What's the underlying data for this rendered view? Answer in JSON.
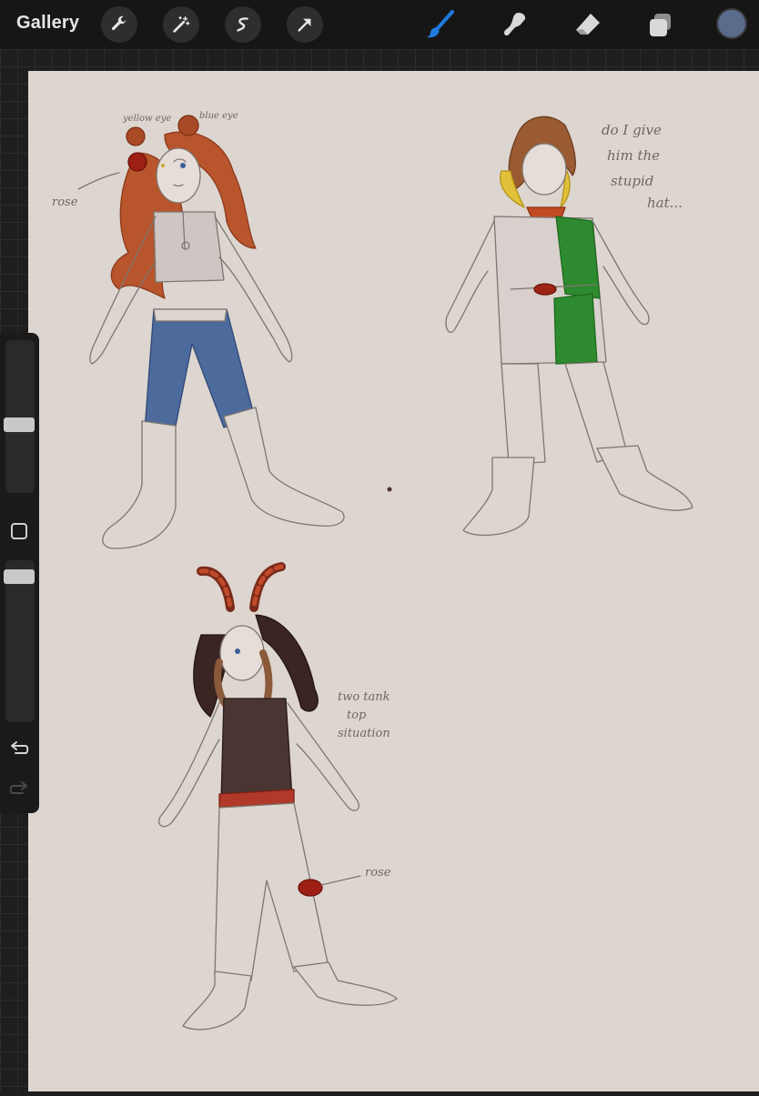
{
  "toolbar": {
    "gallery_label": "Gallery",
    "left_tools": [
      "wrench-icon",
      "magic-wand-icon",
      "selection-icon",
      "transform-arrow-icon"
    ],
    "right_tools": [
      "brush-icon",
      "smudge-icon",
      "eraser-icon",
      "layers-icon"
    ],
    "active_tool": "brush-icon",
    "accent_color": "#1f7ae0",
    "current_color": "#5a6b8c"
  },
  "canvas": {
    "background": "#ddd5cf",
    "annotations": {
      "eye_note_left": "yellow eye",
      "eye_note_right": "blue eye",
      "rose_note": "rose",
      "hat_note": "do I give him the stupid hat...",
      "tank_note": "two tank top situation",
      "rose_note_2": "rose"
    }
  },
  "sidebar": {
    "size_slider_value": 0.45,
    "opacity_slider_value": 0.95
  }
}
